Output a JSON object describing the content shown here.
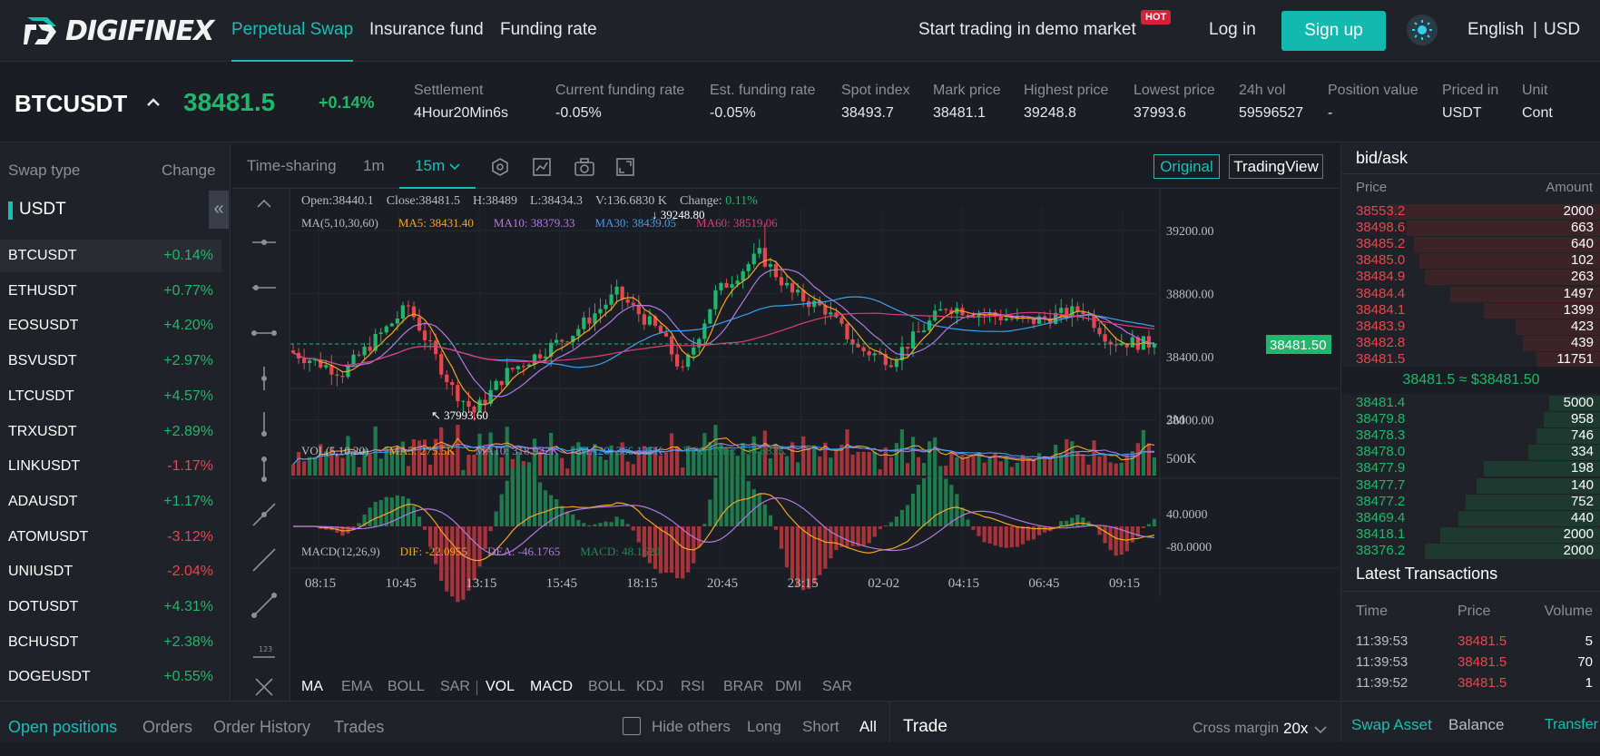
{
  "nav": {
    "logo": "DIGIFINEX",
    "links": [
      "Perpetual Swap",
      "Insurance fund",
      "Funding rate"
    ],
    "demo": "Start trading in demo market",
    "hot": "HOT",
    "login": "Log in",
    "signup": "Sign up",
    "lang": "English",
    "sep": "|",
    "currency": "USD"
  },
  "ticker": {
    "symbol": "BTCUSDT",
    "price": "38481.5",
    "change": "+0.14%",
    "stats": [
      {
        "label": "Settlement",
        "value": "4Hour20Min6s"
      },
      {
        "label": "Current funding rate",
        "value": "-0.05%"
      },
      {
        "label": "Est. funding rate",
        "value": "-0.05%"
      },
      {
        "label": "Spot index",
        "value": "38493.7"
      },
      {
        "label": "Mark price",
        "value": "38481.1"
      },
      {
        "label": "Highest price",
        "value": "39248.8"
      },
      {
        "label": "Lowest price",
        "value": "37993.6"
      },
      {
        "label": "24h vol",
        "value": "59596527"
      },
      {
        "label": "Position value",
        "value": "-"
      },
      {
        "label": "Priced in",
        "value": "USDT"
      },
      {
        "label": "Unit",
        "value": "Cont"
      }
    ]
  },
  "swap": {
    "header_type": "Swap type",
    "header_change": "Change",
    "group": "USDT",
    "collapse": "«",
    "rows": [
      {
        "symbol": "BTCUSDT",
        "change": "+0.14%"
      },
      {
        "symbol": "ETHUSDT",
        "change": "+0.77%"
      },
      {
        "symbol": "EOSUSDT",
        "change": "+4.20%"
      },
      {
        "symbol": "BSVUSDT",
        "change": "+2.97%"
      },
      {
        "symbol": "LTCUSDT",
        "change": "+4.57%"
      },
      {
        "symbol": "TRXUSDT",
        "change": "+2.89%"
      },
      {
        "symbol": "LINKUSDT",
        "change": "-1.17%"
      },
      {
        "symbol": "ADAUSDT",
        "change": "+1.17%"
      },
      {
        "symbol": "ATOMUSDT",
        "change": "-3.12%"
      },
      {
        "symbol": "UNIUSDT",
        "change": "-2.04%"
      },
      {
        "symbol": "DOTUSDT",
        "change": "+4.31%"
      },
      {
        "symbol": "BCHUSDT",
        "change": "+2.38%"
      },
      {
        "symbol": "DOGEUSDT",
        "change": "+0.55%"
      }
    ]
  },
  "chart_toolbar": {
    "timesharing": "Time-sharing",
    "m1": "1m",
    "m15": "15m",
    "original": "Original",
    "tradingview": "TradingView"
  },
  "chart_info": {
    "open": "Open:38440.1",
    "close": "Close:38481.5",
    "high": "H:38489",
    "low": "L:38434.3",
    "vol": "V:136.6830 K",
    "change_label": "Change:",
    "change_value": "0.11%",
    "ma_label": "MA(5,10,30,60)",
    "ma5": "MA5: 38431.40",
    "ma10": "MA10: 38379.33",
    "ma30": "MA30: 38439.05",
    "ma60": "MA60: 38519.06",
    "high_mark": "39248.80",
    "low_mark": "37993.60",
    "last_price": "38481.50",
    "vol_label": "VOL(5,10,20)",
    "vol_ma5": "MA5: 275.5K",
    "vol_ma10": "MA10: 318.932K",
    "vol_ma20": "MA20: 366.125K",
    "vol_volume": "VOLUME: 136.683K",
    "macd_label": "MACD(12,26,9)",
    "dif": "DIF: -22.0955",
    "dea": "DEA: -46.1765",
    "macd": "MACD: 48.1620"
  },
  "chart_data": {
    "type": "candlestick",
    "price_ticks": [
      "39200.00",
      "38800.00",
      "38400.00",
      "38000.00"
    ],
    "vol_ticks": [
      "2M",
      "500K"
    ],
    "macd_ticks": [
      "40.0000",
      "-80.0000"
    ],
    "time_ticks": [
      "08:15",
      "10:45",
      "13:15",
      "15:45",
      "18:15",
      "20:45",
      "23:15",
      "02-02",
      "04:15",
      "06:45",
      "09:15"
    ],
    "ylim": [
      37900,
      39350
    ],
    "high": 39248.8,
    "low": 37993.6,
    "last": 38481.5
  },
  "indicators": {
    "main": [
      "MA",
      "EMA",
      "BOLL",
      "SAR"
    ],
    "sub": [
      "VOL",
      "MACD",
      "BOLL",
      "KDJ",
      "RSI",
      "BRAR",
      "DMI",
      "SAR"
    ]
  },
  "orderbook": {
    "title": "bid/ask",
    "h_price": "Price",
    "h_amount": "Amount",
    "asks": [
      {
        "price": "38553.2",
        "amount": "2000",
        "depth": 0.82
      },
      {
        "price": "38498.6",
        "amount": "663",
        "depth": 0.75
      },
      {
        "price": "38485.2",
        "amount": "640",
        "depth": 0.72
      },
      {
        "price": "38485.0",
        "amount": "102",
        "depth": 0.7
      },
      {
        "price": "38484.9",
        "amount": "263",
        "depth": 0.68
      },
      {
        "price": "38484.4",
        "amount": "1497",
        "depth": 0.58
      },
      {
        "price": "38484.1",
        "amount": "1399",
        "depth": 0.45
      },
      {
        "price": "38483.9",
        "amount": "423",
        "depth": 0.33
      },
      {
        "price": "38482.8",
        "amount": "439",
        "depth": 0.3
      },
      {
        "price": "38481.5",
        "amount": "11751",
        "depth": 0.25
      }
    ],
    "mid": "38481.5 ≈ $38481.50",
    "bids": [
      {
        "price": "38481.4",
        "amount": "5000",
        "depth": 0.2
      },
      {
        "price": "38479.8",
        "amount": "958",
        "depth": 0.22
      },
      {
        "price": "38478.3",
        "amount": "746",
        "depth": 0.25
      },
      {
        "price": "38478.0",
        "amount": "334",
        "depth": 0.28
      },
      {
        "price": "38477.9",
        "amount": "198",
        "depth": 0.45
      },
      {
        "price": "38477.7",
        "amount": "140",
        "depth": 0.48
      },
      {
        "price": "38477.2",
        "amount": "752",
        "depth": 0.52
      },
      {
        "price": "38469.4",
        "amount": "440",
        "depth": 0.55
      },
      {
        "price": "38418.1",
        "amount": "2000",
        "depth": 0.62
      },
      {
        "price": "38376.2",
        "amount": "2000",
        "depth": 0.68
      }
    ],
    "lt_title": "Latest Transactions",
    "lt_time": "Time",
    "lt_price": "Price",
    "lt_volume": "Volume",
    "trades": [
      {
        "time": "11:39:53",
        "price": "38481.5",
        "volume": "5"
      },
      {
        "time": "11:39:53",
        "price": "38481.5",
        "volume": "70"
      },
      {
        "time": "11:39:52",
        "price": "38481.5",
        "volume": "1"
      }
    ]
  },
  "bottom": {
    "tabs": [
      "Open positions",
      "Orders",
      "Order History",
      "Trades"
    ],
    "hide_others": "Hide others",
    "long": "Long",
    "short": "Short",
    "all": "All",
    "trade": "Trade",
    "cross_margin": "Cross margin",
    "leverage": "20x",
    "swap_asset": "Swap Asset",
    "balance": "Balance",
    "transfer": "Transfer"
  },
  "colors": {
    "accent": "#16c0b6",
    "up": "#21b66b",
    "down": "#e5474f"
  }
}
